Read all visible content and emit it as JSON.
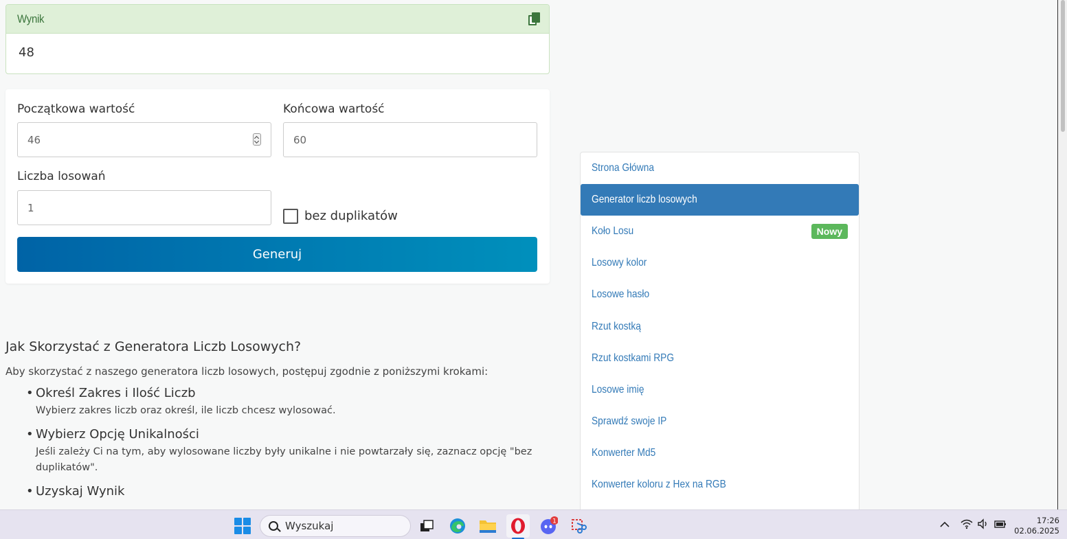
{
  "result": {
    "title": "Wynik",
    "value": "48",
    "copy_icon": "copy-icon"
  },
  "form": {
    "start_label": "Początkowa wartość",
    "start_value": "46",
    "end_label": "Końcowa wartość",
    "end_value": "60",
    "count_label": "Liczba losowań",
    "count_value": "1",
    "no_duplicates_label": "bez duplikatów",
    "no_duplicates_checked": false,
    "generate_button": "Generuj"
  },
  "article": {
    "heading": "Jak Skorzystać z Generatora Liczb Losowych?",
    "intro": "Aby skorzystać z naszego generatora liczb losowych, postępuj zgodnie z poniższymi krokami:",
    "steps": [
      {
        "title": "Określ Zakres i Ilość Liczb",
        "desc": "Wybierz zakres liczb oraz określ, ile liczb chcesz wylosować."
      },
      {
        "title": "Wybierz Opcję Unikalności",
        "desc": "Jeśli zależy Ci na tym, aby wylosowane liczby były unikalne i nie powtarzały się, zaznacz opcję \"bez duplikatów\"."
      },
      {
        "title": "Uzyskaj Wynik"
      }
    ]
  },
  "nav": {
    "items": [
      {
        "label": "Strona Główna"
      },
      {
        "label": "Generator liczb losowych",
        "active": true
      },
      {
        "label": "Koło Losu",
        "badge": "Nowy"
      },
      {
        "label": "Losowy kolor"
      },
      {
        "label": "Losowe hasło"
      },
      {
        "label": "Rzut kostką"
      },
      {
        "label": "Rzut kostkami RPG"
      },
      {
        "label": "Losowe imię"
      },
      {
        "label": "Sprawdź swoje IP"
      },
      {
        "label": "Konwerter Md5"
      },
      {
        "label": "Konwerter koloru z Hex na RGB"
      }
    ]
  },
  "taskbar": {
    "search_placeholder": "Wyszukaj",
    "discord_badge": "1",
    "time": "17:26",
    "date": "02.06.2025"
  },
  "colors": {
    "result_header_bg": "#dff0d8",
    "result_title": "#3c763d",
    "nav_link": "#337ab7",
    "nav_active_bg": "#337ab7",
    "badge_bg": "#5cb85c",
    "button_gradient_start": "#0063a6",
    "button_gradient_end": "#0090bc"
  }
}
